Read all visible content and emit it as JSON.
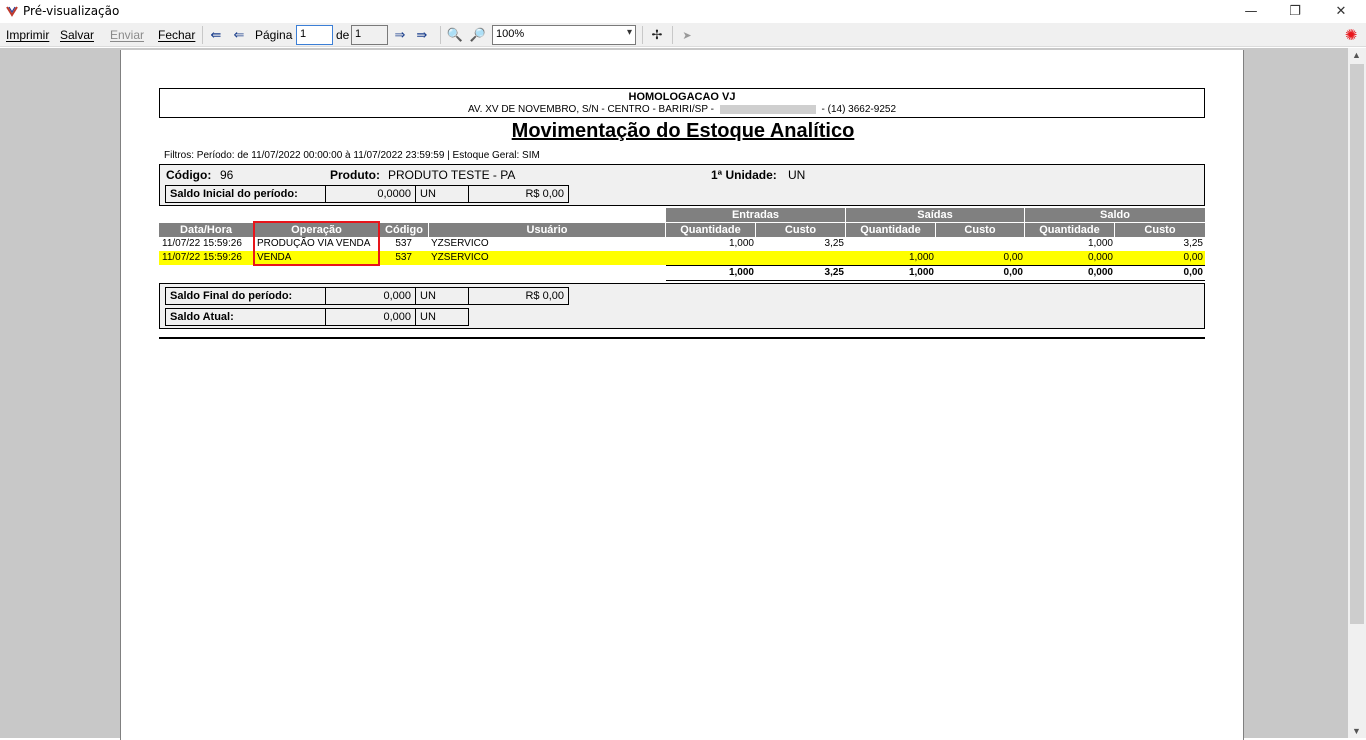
{
  "window": {
    "title": "Pré-visualização",
    "min_glyph": "—",
    "restore_glyph": "❐",
    "close_glyph": "✕",
    "app_icon": "preview-app-icon"
  },
  "toolbar": {
    "print_label": "Imprimir",
    "save_label": "Salvar",
    "send_label": "Enviar",
    "close_label": "Fechar",
    "first_page_glyph": "⇚",
    "prev_page_glyph": "⇐",
    "page_label": "Página",
    "page_value": "1",
    "of_label": "de",
    "total_pages": "1",
    "next_page_glyph": "⇒",
    "last_page_glyph": "⇛",
    "zoom_out_glyph": "🔍",
    "zoom_in_glyph": "🔎",
    "zoom_value": "100%",
    "zoom_arrow": "▾",
    "fit_glyph": "✢",
    "pointer_glyph": "➤",
    "logo_glyph": "✺"
  },
  "scroll": {
    "up": "▲",
    "down": "▼"
  },
  "report": {
    "company": "HOMOLOGACAO VJ",
    "address_prefix": "AV. XV DE NOVEMBRO, S/N - CENTRO - BARIRI/SP -",
    "address_suffix": "- (14) 3662-9252",
    "title": "Movimentação do Estoque Analítico",
    "filters": "Filtros: Período: de 11/07/2022 00:00:00 à 11/07/2022 23:59:59 | Estoque Geral: SIM",
    "product": {
      "code_label": "Código:",
      "code_value": "96",
      "product_label": "Produto:",
      "product_value": "PRODUTO TESTE - PA",
      "unit_label": "1ª Unidade:",
      "unit_value": "UN",
      "initial_label": "Saldo Inicial do período:",
      "initial_qty": "0,0000",
      "initial_unit": "UN",
      "initial_value": "R$ 0,00"
    },
    "groups": {
      "in": "Entradas",
      "out": "Saídas",
      "balance": "Saldo"
    },
    "columns": {
      "datetime": "Data/Hora",
      "operation": "Operação",
      "code": "Código",
      "user": "Usuário",
      "in_qty": "Quantidade",
      "in_cost": "Custo",
      "out_qty": "Quantidade",
      "out_cost": "Custo",
      "bal_qty": "Quantidade",
      "bal_cost": "Custo"
    },
    "rows": [
      {
        "datetime": "11/07/22 15:59:26",
        "operation": "PRODUÇÃO VIA VENDA",
        "code": "537",
        "user": "YZSERVICO",
        "in_qty": "1,000",
        "in_cost": "3,25",
        "out_qty": "",
        "out_cost": "",
        "bal_qty": "1,000",
        "bal_cost": "3,25"
      },
      {
        "datetime": "11/07/22 15:59:26",
        "operation": "VENDA",
        "code": "537",
        "user": "YZSERVICO",
        "in_qty": "",
        "in_cost": "",
        "out_qty": "1,000",
        "out_cost": "0,00",
        "bal_qty": "0,000",
        "bal_cost": "0,00"
      }
    ],
    "totals": {
      "in_qty": "1,000",
      "in_cost": "3,25",
      "out_qty": "1,000",
      "out_cost": "0,00",
      "bal_qty": "0,000",
      "bal_cost": "0,00"
    },
    "final": {
      "final_label": "Saldo Final do período:",
      "final_qty": "0,000",
      "final_unit": "UN",
      "final_value": "R$ 0,00",
      "current_label": "Saldo Atual:",
      "current_qty": "0,000",
      "current_unit": "UN"
    },
    "highlight_color": "#ffff00",
    "annotation_color": "#e8151b"
  }
}
